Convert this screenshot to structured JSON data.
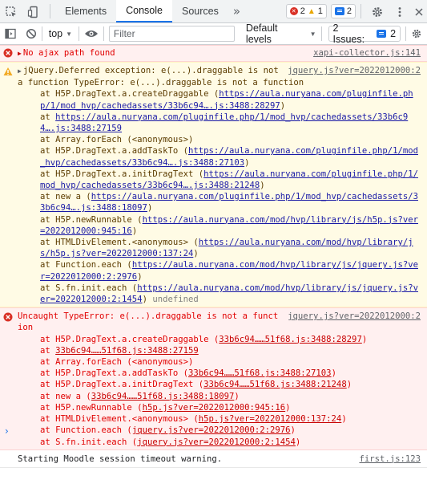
{
  "tabs": [
    "Elements",
    "Console",
    "Sources"
  ],
  "tab_more": "»",
  "badges": {
    "errors": "2",
    "warnings": "1",
    "messages": "2"
  },
  "toolbar": {
    "context": "top",
    "filter_placeholder": "Filter",
    "levels": "Default levels",
    "issues_label": "2 Issues:",
    "issues_count": "2"
  },
  "colors": {
    "accent": "#1a73e8",
    "error": "#e10000",
    "warning_bg": "#fffbe5",
    "error_bg": "#fff0f0"
  },
  "messages": [
    {
      "text": "No ajax path found",
      "source": "xapi-collector.js:141"
    },
    {
      "head": "jQuery.Deferred exception: e(...).draggable is not a function TypeError: e(...).draggable is not a function",
      "source": "jquery.js?ver=2022012000:2",
      "stack": [
        {
          "fn": "at H5P.DragText.a.createDraggable (",
          "url": "https://aula.nuryana.com/pluginfile.php/1/mod_hvp/cachedassets/33b6c94….js:3488:28297",
          "end": ")"
        },
        {
          "fn": "at ",
          "url": "https://aula.nuryana.com/pluginfile.php/1/mod_hvp/cachedassets/33b6c94….js:3488:27159",
          "end": ""
        },
        {
          "fn": "at Array.forEach (<anonymous>)",
          "url": "",
          "end": ""
        },
        {
          "fn": "at H5P.DragText.a.addTaskTo (",
          "url": "https://aula.nuryana.com/pluginfile.php/1/mod_hvp/cachedassets/33b6c94….js:3488:27103",
          "end": ")"
        },
        {
          "fn": "at H5P.DragText.a.initDragText (",
          "url": "https://aula.nuryana.com/pluginfile.php/1/mod_hvp/cachedassets/33b6c94….js:3488:21248",
          "end": ")"
        },
        {
          "fn": "at new a (",
          "url": "https://aula.nuryana.com/pluginfile.php/1/mod_hvp/cachedassets/33b6c94….js:3488:18097",
          "end": ")"
        },
        {
          "fn": "at H5P.newRunnable (",
          "url": "https://aula.nuryana.com/mod/hvp/library/js/h5p.js?ver=2022012000:945:16",
          "end": ")"
        },
        {
          "fn": "at HTMLDivElement.<anonymous> (",
          "url": "https://aula.nuryana.com/mod/hvp/library/js/h5p.js?ver=2022012000:137:24",
          "end": ")"
        },
        {
          "fn": "at Function.each (",
          "url": "https://aula.nuryana.com/mod/hvp/library/js/jquery.js?ver=2022012000:2:2976",
          "end": ")"
        },
        {
          "fn": "at S.fn.init.each (",
          "url": "https://aula.nuryana.com/mod/hvp/library/js/jquery.js?ver=2022012000:2:1454",
          "end": ")"
        }
      ],
      "tail": "undefined"
    },
    {
      "head": "Uncaught TypeError: e(...).draggable is not a function",
      "source": "jquery.js?ver=2022012000:2",
      "stack": [
        {
          "fn": "at H5P.DragText.a.createDraggable (",
          "url": "33b6c94……51f68.js:3488:28297",
          "end": ")"
        },
        {
          "fn": "at ",
          "url": "33b6c94……51f68.js:3488:27159",
          "end": ""
        },
        {
          "fn": "at Array.forEach (<anonymous>)",
          "url": "",
          "end": ""
        },
        {
          "fn": "at H5P.DragText.a.addTaskTo (",
          "url": "33b6c94……51f68.js:3488:27103",
          "end": ")"
        },
        {
          "fn": "at H5P.DragText.a.initDragText (",
          "url": "33b6c94……51f68.js:3488:21248",
          "end": ")"
        },
        {
          "fn": "at new a (",
          "url": "33b6c94……51f68.js:3488:18097",
          "end": ")"
        },
        {
          "fn": "at H5P.newRunnable (",
          "url": "h5p.js?ver=2022012000:945:16",
          "end": ")"
        },
        {
          "fn": "at HTMLDivElement.<anonymous> (",
          "url": "h5p.js?ver=2022012000:137:24",
          "end": ")"
        },
        {
          "fn": "at Function.each (",
          "url": "jquery.js?ver=2022012000:2:2976",
          "end": ")"
        },
        {
          "fn": "at S.fn.init.each (",
          "url": "jquery.js?ver=2022012000:2:1454",
          "end": ")"
        }
      ]
    },
    {
      "text": "Starting Moodle session timeout warning.",
      "source": "first.js:123"
    }
  ],
  "prompt": "›"
}
